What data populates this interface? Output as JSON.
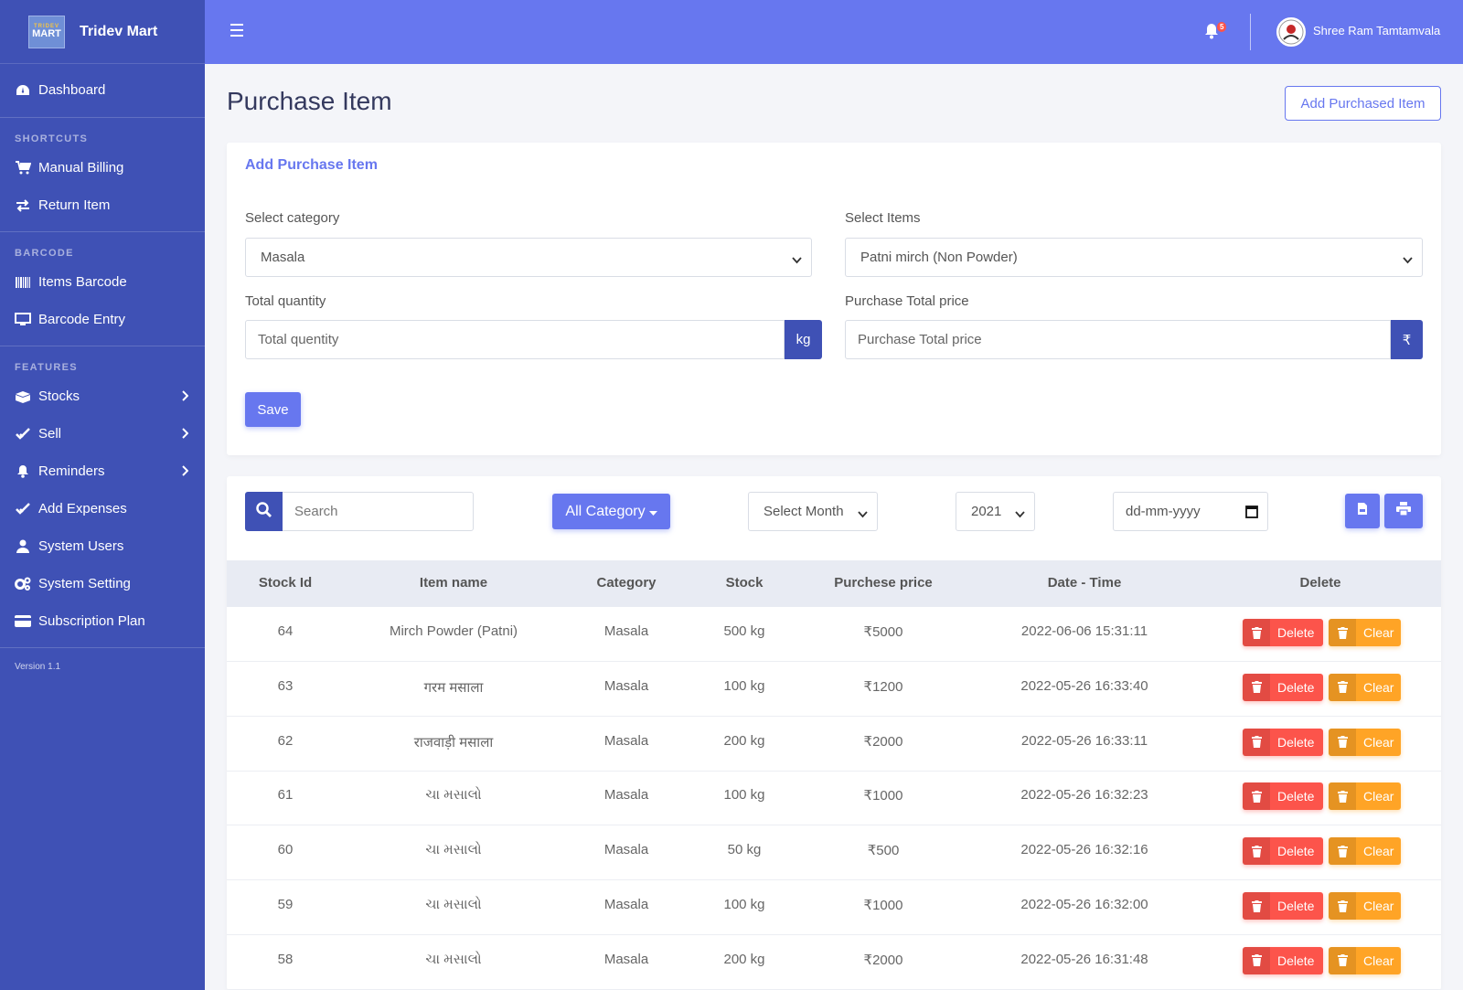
{
  "brand": {
    "logo_top": "TRIDEV",
    "logo_bottom": "MART",
    "name": "Tridev Mart"
  },
  "sidebar": {
    "dashboard": "Dashboard",
    "sections": {
      "shortcuts": "SHORTCUTS",
      "barcode": "BARCODE",
      "features": "FEATURES"
    },
    "items": {
      "manual_billing": "Manual Billing",
      "return_item": "Return Item",
      "items_barcode": "Items Barcode",
      "barcode_entry": "Barcode Entry",
      "stocks": "Stocks",
      "sell": "Sell",
      "reminders": "Reminders",
      "add_expenses": "Add Expenses",
      "system_users": "System Users",
      "system_setting": "System Setting",
      "subscription_plan": "Subscription Plan"
    },
    "version": "Version 1.1"
  },
  "topbar": {
    "notification_count": "5",
    "user_name": "Shree Ram Tamtamvala"
  },
  "page": {
    "title": "Purchase Item",
    "add_button": "Add Purchased Item"
  },
  "form": {
    "header": "Add Purchase Item",
    "category_label": "Select category",
    "category_value": "Masala",
    "items_label": "Select Items",
    "items_value": "Patni mirch (Non Powder)",
    "quantity_label": "Total quantity",
    "quantity_placeholder": "Total quentity",
    "quantity_unit": "kg",
    "price_label": "Purchase Total price",
    "price_placeholder": "Purchase Total price",
    "price_unit": "₹",
    "save": "Save"
  },
  "filters": {
    "search_placeholder": "Search",
    "category_button": "All Category",
    "month": "Select Month",
    "year": "2021",
    "date_placeholder": "dd-mm-yyyy"
  },
  "table": {
    "headers": [
      "Stock Id",
      "Item name",
      "Category",
      "Stock",
      "Purchese price",
      "Date - Time",
      "Delete"
    ],
    "delete_label": "Delete",
    "clear_label": "Clear",
    "rows": [
      [
        "64",
        "Mirch Powder (Patni)",
        "Masala",
        "500 kg",
        "₹5000",
        "2022-06-06 15:31:11"
      ],
      [
        "63",
        "गरम मसाला",
        "Masala",
        "100 kg",
        "₹1200",
        "2022-05-26 16:33:40"
      ],
      [
        "62",
        "राजवाड़ी मसाला",
        "Masala",
        "200 kg",
        "₹2000",
        "2022-05-26 16:33:11"
      ],
      [
        "61",
        "ચા મસાલો",
        "Masala",
        "100 kg",
        "₹1000",
        "2022-05-26 16:32:23"
      ],
      [
        "60",
        "ચા મસાલો",
        "Masala",
        "50 kg",
        "₹500",
        "2022-05-26 16:32:16"
      ],
      [
        "59",
        "ચા મસાલો",
        "Masala",
        "100 kg",
        "₹1000",
        "2022-05-26 16:32:00"
      ],
      [
        "58",
        "ચા મસાલો",
        "Masala",
        "200 kg",
        "₹2000",
        "2022-05-26 16:31:48"
      ]
    ]
  }
}
